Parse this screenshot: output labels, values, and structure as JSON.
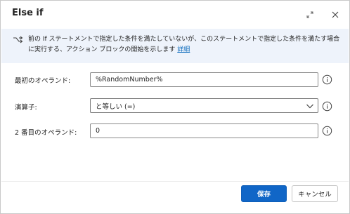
{
  "dialog": {
    "title": "Else if"
  },
  "info": {
    "text": "前の If ステートメントで指定した条件を満たしていないが、このステートメントで指定した条件を満たす場合に実行する、アクション ブロックの開始を示します",
    "link": "詳細"
  },
  "fields": {
    "first_operand_label": "最初のオペランド:",
    "first_operand_value": "%RandomNumber%",
    "operator_label": "演算子:",
    "operator_value": "と等しい (=)",
    "second_operand_label": "2 番目のオペランド:",
    "second_operand_value": "0"
  },
  "footer": {
    "save": "保存",
    "cancel": "キャンセル"
  },
  "colors": {
    "primary": "#1066c7",
    "info_background": "#eef3fb",
    "link": "#0f6cbd"
  },
  "icons": {
    "expand": "expand-arrows-icon",
    "close": "close-icon",
    "info_bar": "branch-arrow-icon",
    "help": "info-circle-icon",
    "dropdown": "chevron-down-icon"
  }
}
